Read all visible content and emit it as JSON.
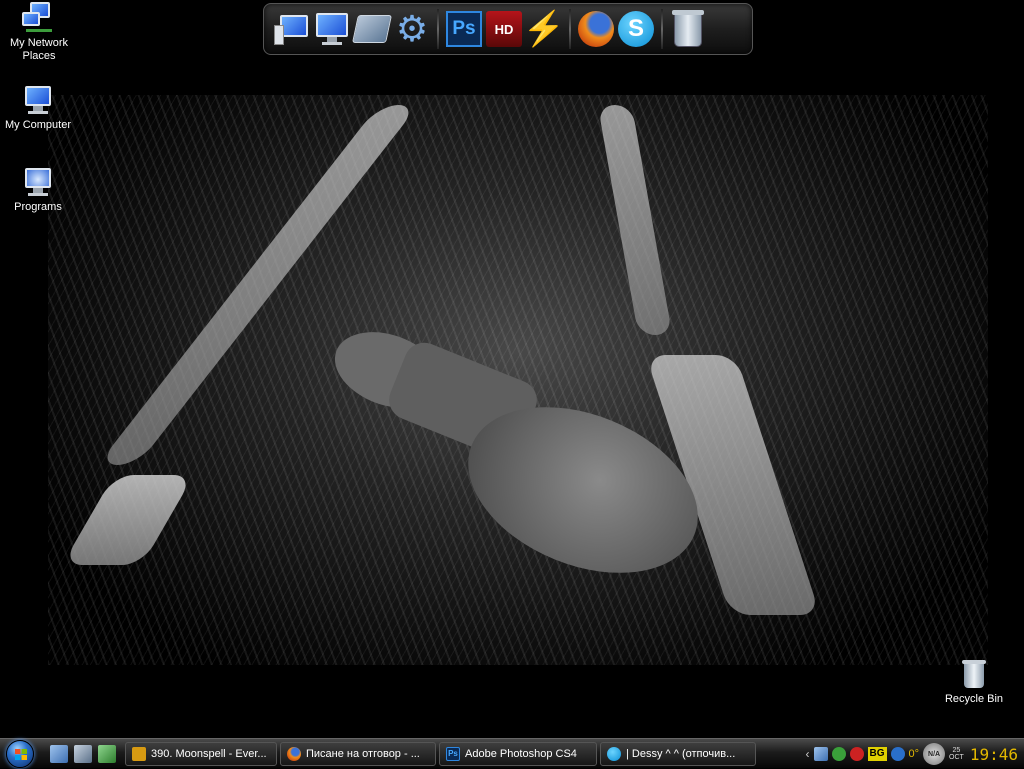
{
  "desktop_icons": [
    {
      "label": "My Network Places",
      "icon": "network-places-icon"
    },
    {
      "label": "My Computer",
      "icon": "computer-icon"
    },
    {
      "label": "Programs",
      "icon": "programs-icon"
    },
    {
      "label": "Recycle Bin",
      "icon": "recycle-bin-icon"
    }
  ],
  "dock": {
    "items": [
      {
        "name": "computer-icon"
      },
      {
        "name": "monitor-icon"
      },
      {
        "name": "drive-icon"
      },
      {
        "name": "gear-icon"
      },
      {
        "name": "photoshop-icon",
        "text": "Ps"
      },
      {
        "name": "hd-video-icon",
        "text": "HD"
      },
      {
        "name": "winamp-icon"
      },
      {
        "name": "firefox-icon"
      },
      {
        "name": "skype-icon",
        "text": "S"
      },
      {
        "name": "trash-icon"
      }
    ]
  },
  "taskbar": {
    "tasks": [
      {
        "label": "390. Moonspell - Ever...",
        "icon": "winamp-icon"
      },
      {
        "label": "Писане на отговор - ...",
        "icon": "firefox-icon"
      },
      {
        "label": "Adobe Photoshop CS4",
        "icon": "photoshop-icon"
      },
      {
        "label": "| Dessy ^ ^ (отпочив...",
        "icon": "skype-icon"
      }
    ],
    "tray": {
      "language": "BG",
      "temperature": "0°",
      "na_badge": "N/A",
      "date_day": "25",
      "date_month": "OCT",
      "time": "19:46"
    }
  },
  "colors": {
    "accent_clock": "#e3b800",
    "taskbar_bg": "#1c1c1c",
    "desktop_bg": "#000000"
  }
}
